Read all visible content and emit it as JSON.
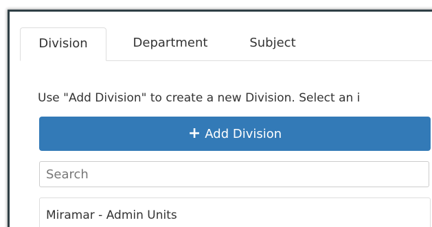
{
  "tabs": [
    {
      "label": "Division"
    },
    {
      "label": "Department"
    },
    {
      "label": "Subject"
    }
  ],
  "instructions": "Use \"Add Division\" to create a new Division. Select an i",
  "add_button": {
    "icon": "+",
    "label": "Add Division"
  },
  "search": {
    "placeholder": "Search",
    "value": ""
  },
  "list": [
    {
      "label": "Miramar - Admin Units"
    }
  ],
  "colors": {
    "accent": "#337ab7",
    "frame": "#2f3f45"
  }
}
